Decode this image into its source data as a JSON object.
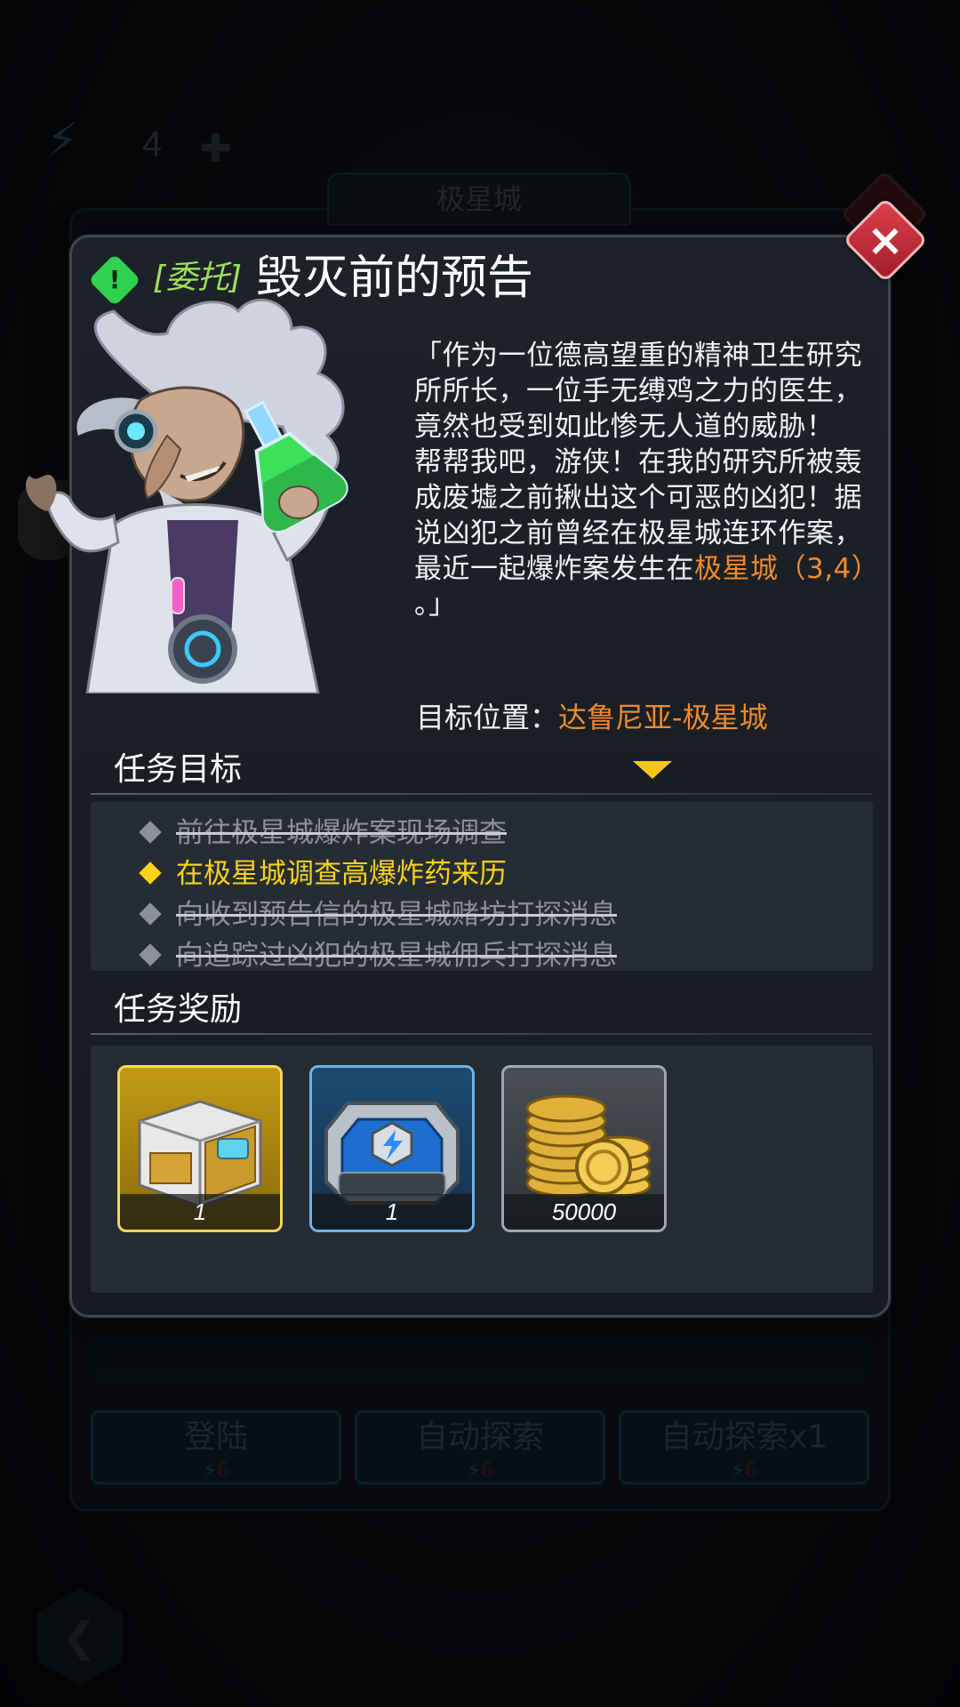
{
  "background": {
    "energy_count": "4",
    "area_title": "极星城",
    "buttons": [
      {
        "label": "登陆",
        "cost": "6"
      },
      {
        "label": "自动探索",
        "cost": "6"
      },
      {
        "label": "自动探索x1",
        "cost": "6"
      }
    ]
  },
  "dialog": {
    "tag": "[委托]",
    "title": "毁灭前的预告",
    "story_parts": [
      {
        "text": "「作为一位德高望重的精神卫生研究所所长，一位手无缚鸡之力的医生，竟然也受到如此惨无人道的威胁！\n帮帮我吧，游侠！在我的研究所被轰成废墟之前揪出这个可恶的凶犯！据说凶犯之前曾经在极星城连环作案，最近一起爆炸案发生在"
      },
      {
        "text": "极星城（3,4）"
      },
      {
        "text": "\n。」"
      }
    ],
    "target_label": "目标位置：",
    "target_value": "达鲁尼亚-极星城",
    "objectives_title": "任务目标",
    "objectives": [
      {
        "text": "前往极星城爆炸案现场调查",
        "status": "done"
      },
      {
        "text": "在极星城调查高爆炸药来历",
        "status": "active"
      },
      {
        "text": "向收到预告信的极星城赌坊打探消息",
        "status": "done"
      },
      {
        "text": "向追踪过凶犯的极星城佣兵打探消息",
        "status": "done"
      }
    ],
    "rewards_title": "任务奖励",
    "rewards": [
      {
        "item": "supply-crate",
        "quantity": "1",
        "frame": "gold"
      },
      {
        "item": "energy-battery",
        "quantity": "1",
        "frame": "blue"
      },
      {
        "item": "gold-coins",
        "quantity": "50000",
        "frame": "gray"
      }
    ]
  },
  "colors": {
    "highlight_orange": "#f08a2c",
    "active_objective": "#f8d21c",
    "tag_green": "#9ee05a",
    "close_red": "#c8303b"
  }
}
